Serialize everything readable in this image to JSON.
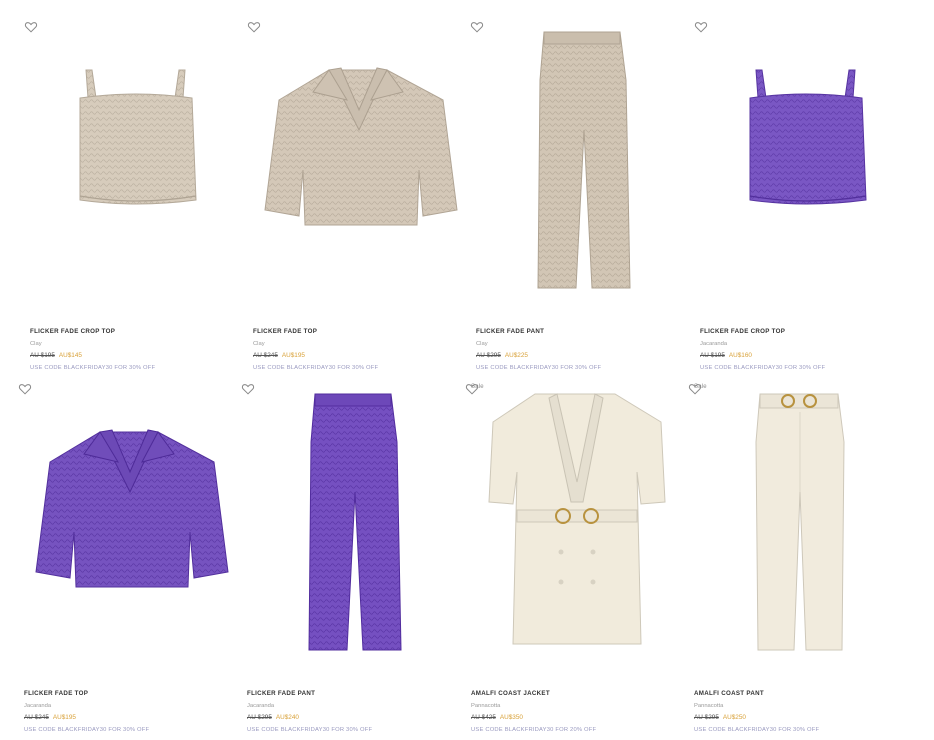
{
  "products": [
    {
      "name": "FLICKER FADE CROP TOP",
      "color": "Clay",
      "old_price": "AU $195",
      "new_price": "AU$145",
      "promo": "USE CODE BLACKFRIDAY30 FOR 30% OFF",
      "badge": "",
      "garment": "crop-top",
      "fill": "#d7ccbc"
    },
    {
      "name": "FLICKER FADE TOP",
      "color": "Clay",
      "old_price": "AU $245",
      "new_price": "AU$195",
      "promo": "USE CODE BLACKFRIDAY30 FOR 30% OFF",
      "badge": "",
      "garment": "polo-top",
      "fill": "#d4c8b8"
    },
    {
      "name": "FLICKER FADE PANT",
      "color": "Clay",
      "old_price": "AU $295",
      "new_price": "AU$225",
      "promo": "USE CODE BLACKFRIDAY30 FOR 30% OFF",
      "badge": "",
      "garment": "pant",
      "fill": "#d2c6b5"
    },
    {
      "name": "FLICKER FADE CROP TOP",
      "color": "Jacaranda",
      "old_price": "AU $195",
      "new_price": "AU$160",
      "promo": "USE CODE BLACKFRIDAY30 FOR 30% OFF",
      "badge": "",
      "garment": "crop-top",
      "fill": "#7a57c4"
    },
    {
      "name": "FLICKER FADE TOP",
      "color": "Jacaranda",
      "old_price": "AU $245",
      "new_price": "AU$195",
      "promo": "USE CODE BLACKFRIDAY30 FOR 30% OFF",
      "badge": "",
      "garment": "polo-top",
      "fill": "#7653c0"
    },
    {
      "name": "FLICKER FADE PANT",
      "color": "Jacaranda",
      "old_price": "AU $295",
      "new_price": "AU$240",
      "promo": "USE CODE BLACKFRIDAY30 FOR 30% OFF",
      "badge": "",
      "garment": "pant",
      "fill": "#7550c1"
    },
    {
      "name": "AMALFI COAST JACKET",
      "color": "Pannacotta",
      "old_price": "AU $425",
      "new_price": "AU$350",
      "promo": "USE CODE BLACKFRIDAY30 FOR 20% OFF",
      "badge": "Sale",
      "garment": "jacket",
      "fill": "#f1ebdc"
    },
    {
      "name": "AMALFI COAST PANT",
      "color": "Pannacotta",
      "old_price": "AU $295",
      "new_price": "AU$250",
      "promo": "USE CODE BLACKFRIDAY30 FOR 30% OFF",
      "badge": "Sale",
      "garment": "belted-pant",
      "fill": "#f1ebdd"
    }
  ],
  "icons": {
    "wishlist": "heart-outline-icon"
  }
}
